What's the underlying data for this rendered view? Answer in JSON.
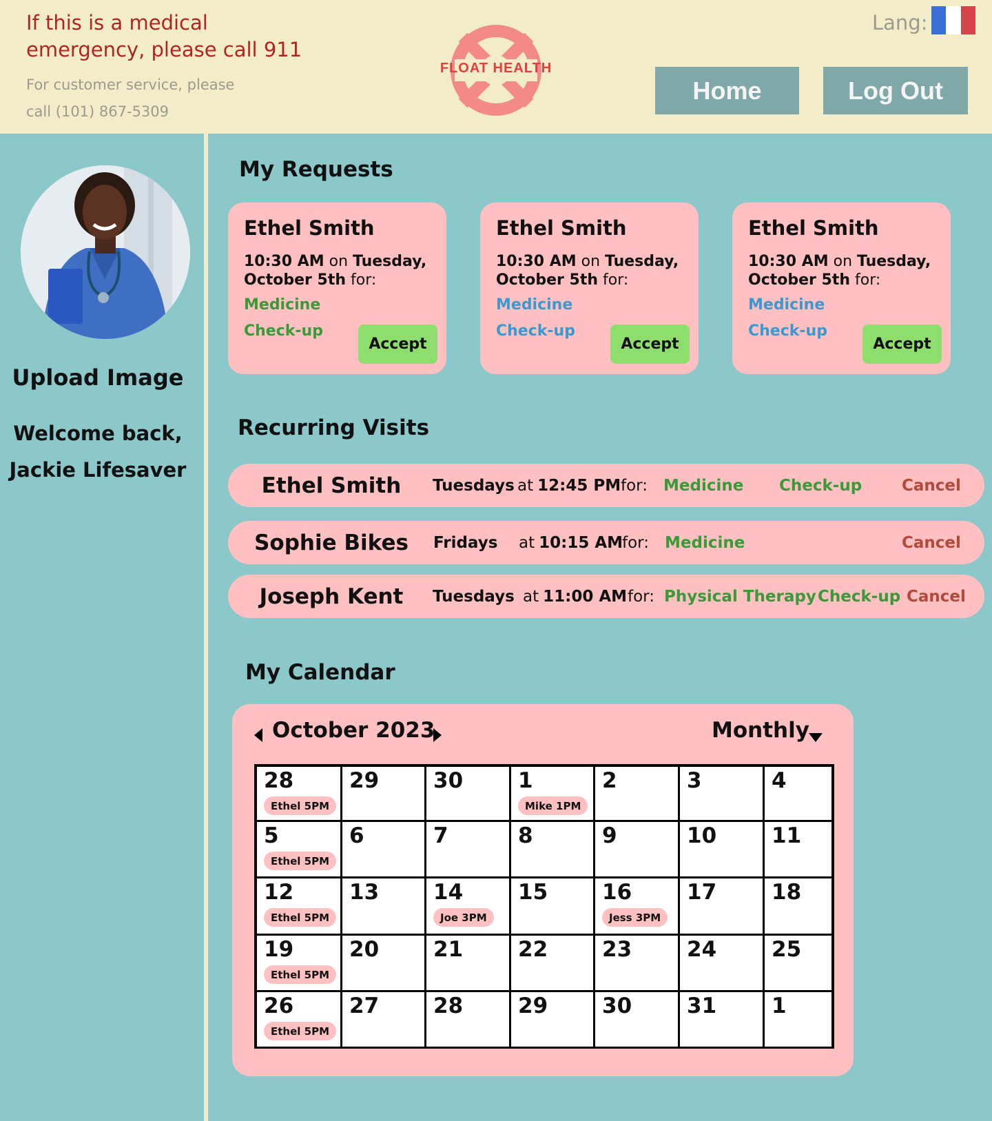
{
  "header": {
    "emergency": "If this is a medical emergency, please call 911",
    "customer_service": "For customer service, please call (101) 867-5309",
    "logo_text": "FLOAT HEALTH",
    "lang_label": "Lang:",
    "flag_colors": [
      "#3a6fd8",
      "#ffffff",
      "#d64545"
    ],
    "home_label": "Home",
    "logout_label": "Log Out"
  },
  "sidebar": {
    "upload_label": "Upload Image",
    "welcome_line1": "Welcome back,",
    "welcome_line2": "Jackie Lifesaver"
  },
  "requests": {
    "title": "My Requests",
    "cards": [
      {
        "name": "Ethel Smith",
        "time": "10:30 AM",
        "on": "on",
        "day": "Tuesday,",
        "date": "October 5th",
        "for": "for:",
        "service1": "Medicine",
        "service2": "Check-up",
        "service_color": "#3a9a3a",
        "accept": "Accept"
      },
      {
        "name": "Ethel Smith",
        "time": "10:30 AM",
        "on": "on",
        "day": "Tuesday,",
        "date": "October 5th",
        "for": "for:",
        "service1": "Medicine",
        "service2": "Check-up",
        "service_color": "#3a9ad0",
        "accept": "Accept"
      },
      {
        "name": "Ethel Smith",
        "time": "10:30 AM",
        "on": "on",
        "day": "Tuesday,",
        "date": "October 5th",
        "for": "for:",
        "service1": "Medicine",
        "service2": "Check-up",
        "service_color": "#3a9ad0",
        "accept": "Accept"
      }
    ]
  },
  "recurring": {
    "title": "Recurring Visits",
    "rows": [
      {
        "name": "Ethel Smith",
        "day": "Tuesdays",
        "at": "at",
        "time": "12:45 PM",
        "for": "for:",
        "service1": "Medicine",
        "service2": "Check-up",
        "cancel": "Cancel"
      },
      {
        "name": "Sophie Bikes",
        "day": "Fridays",
        "at": "at",
        "time": "10:15 AM",
        "for": "for:",
        "service1": "Medicine",
        "service2": "",
        "cancel": "Cancel"
      },
      {
        "name": "Joseph Kent",
        "day": "Tuesdays",
        "at": "at",
        "time": "11:00 AM",
        "for": "for:",
        "service1": "Physical Therapy",
        "service2": "Check-up",
        "cancel": "Cancel"
      }
    ]
  },
  "calendar": {
    "title": "My Calendar",
    "month_label": "October 2023",
    "view_label": "Monthly",
    "weeks": [
      [
        {
          "d": "28",
          "ev": "Ethel 5PM"
        },
        {
          "d": "29"
        },
        {
          "d": "30"
        },
        {
          "d": "1",
          "ev": "Mike 1PM"
        },
        {
          "d": "2"
        },
        {
          "d": "3"
        },
        {
          "d": "4"
        }
      ],
      [
        {
          "d": "5",
          "ev": "Ethel 5PM"
        },
        {
          "d": "6"
        },
        {
          "d": "7"
        },
        {
          "d": "8"
        },
        {
          "d": "9"
        },
        {
          "d": "10"
        },
        {
          "d": "11"
        }
      ],
      [
        {
          "d": "12",
          "ev": "Ethel 5PM"
        },
        {
          "d": "13"
        },
        {
          "d": "14",
          "ev": "Joe   3PM"
        },
        {
          "d": "15"
        },
        {
          "d": "16",
          "ev": "Jess 3PM"
        },
        {
          "d": "17"
        },
        {
          "d": "18"
        }
      ],
      [
        {
          "d": "19",
          "ev": "Ethel 5PM"
        },
        {
          "d": "20"
        },
        {
          "d": "21"
        },
        {
          "d": "22"
        },
        {
          "d": "23"
        },
        {
          "d": "24"
        },
        {
          "d": "25"
        }
      ],
      [
        {
          "d": "26",
          "ev": "Ethel 5PM"
        },
        {
          "d": "27"
        },
        {
          "d": "28"
        },
        {
          "d": "29"
        },
        {
          "d": "30"
        },
        {
          "d": "31"
        },
        {
          "d": "1"
        }
      ]
    ]
  },
  "colors": {
    "bg": "#8cc8ca",
    "header_bg": "#f2edc8",
    "card_bg": "#fec0c0",
    "accept_bg": "#8ede6e",
    "nav_btn_bg": "#80a8a8",
    "emergency_text": "#b02424",
    "logo": "#f28a8a",
    "service_green": "#3a9a3a",
    "cancel": "#b04a3a"
  }
}
